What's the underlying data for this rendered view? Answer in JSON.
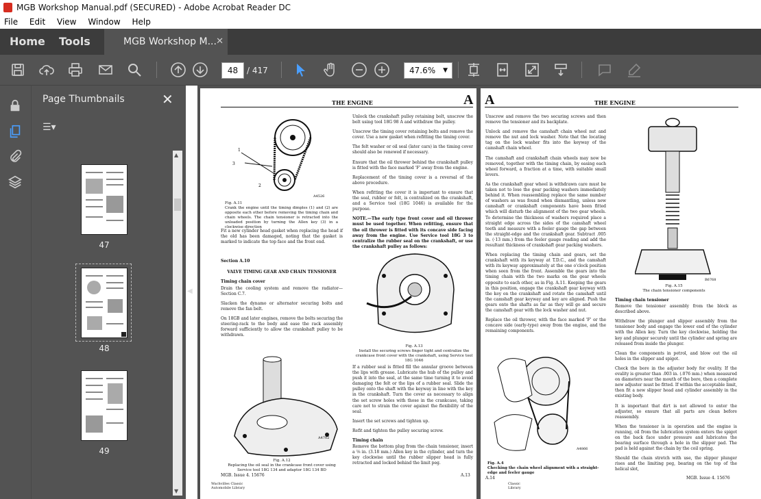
{
  "window": {
    "title": "MGB Workshop Manual.pdf (SECURED) - Adobe Acrobat Reader DC"
  },
  "menu": [
    "File",
    "Edit",
    "View",
    "Window",
    "Help"
  ],
  "tabs": {
    "home": "Home",
    "tools": "Tools",
    "doc": "MGB Workshop M...",
    "close": "✕"
  },
  "toolbar": {
    "page_current": "48",
    "page_total": "/ 417",
    "zoom": "47.6%",
    "zoom_arrow": "▼"
  },
  "thumbnails": {
    "title": "Page Thumbnails",
    "close": "✕",
    "options": "☰▾",
    "pages": [
      "47",
      "48",
      "49"
    ]
  },
  "left_page": {
    "header": "THE ENGINE",
    "letter": "A",
    "fig11_caption": "Fig. A.11\nCrank the engine until the timing dimples (1) and (2) are opposite each other before removing the timing chain and chain wheels. The chain tensioner is retracted into the unloaded position by turning the Allen key (3) in a clockwise direction",
    "col1_after_fig": "Fit a new cylinder head gasket when replacing the head if the old has been damaged, noting that the gasket is marked to indicate the top face and the front end.",
    "section": "Section A.10",
    "section_title": "VALVE TIMING GEAR AND CHAIN TENSIONER",
    "sub_timing_cover": "Timing chain cover",
    "col1_p1": "Drain the cooling system and remove the radiator—Section C.7.",
    "col1_p2": "Slacken the dynamo or alternator securing bolts and remove the fan belt.",
    "col1_p3": "On 18GB and later engines, remove the bolts securing the steering-rack to the body and ease the rack assembly forward sufficiently to allow the crankshaft pulley to be withdrawn.",
    "fig12_caption": "Fig. A.12\nReplacing the oil seal in the crankcase front cover using Service tool 18G 134 and adaptor 18G 134 BD",
    "col2_p1": "Unlock the crankshaft pulley retaining bolt, unscrew the bolt using tool 18G 98 A and withdraw the pulley.",
    "col2_p2": "Unscrew the timing cover retaining bolts and remove the cover. Use a new gasket when refitting the timing cover.",
    "col2_p3": "The felt washer or oil seal (later cars) in the timing cover should also be renewed if necessary.",
    "col2_p4": "Ensure that the oil thrower behind the crankshaft pulley is fitted with the face marked 'F' away from the engine.",
    "col2_p5": "Replacement of the timing cover is a reversal of the above procedure.",
    "col2_p6": "When refitting the cover it is important to ensure that the seal, rubber or felt, is centralized on the crankshaft, and a Service tool (18G 1046) is available for the purpose.",
    "col2_note": "NOTE.—The early type front cover and oil thrower must be used together. When refitting, ensure that the oil thrower is fitted with its concave side facing away from the engine. Use Service tool 18G 3 to centralize the rubber seal on the crankshaft, or use the crankshaft pulley as follows:",
    "fig13_caption": "Fig. A.13\nInstall the securing screws finger tight and centralize the crankcase front cover with the crankshaft, using Service tool 18G 1046",
    "col2_p7": "If a rubber seal is fitted fill the annular groove between the lips with grease. Lubricate the hub of the pulley and push it into the seal, at the same time turning it to avoid damaging the felt or the lips of a rubber seal. Slide the pulley onto the shaft with the keyway in line with the key in the crankshaft. Turn the cover as necessary to align the set screw holes with those in the crankcase, taking care not to strain the cover against the flexibility of the seal.",
    "col2_p8": "Insert the set screws and tighten up.",
    "col2_p9": "Refit and tighten the pulley securing screw.",
    "sub_timing_chain": "Timing chain",
    "col2_p10": "Remove the bottom plug from the chain tensioner, insert a ⅛ in. (3.18 mm.) Allen key in the cylinder, and turn the key clockwise until the rubber slipper head is fully retracted and locked behind the limit peg.",
    "footer_left": "MGB.    Issue 4.    15676",
    "footer_right": "A.13",
    "library": "Wachvilles Classic\nAutomobile Library"
  },
  "right_page": {
    "header": "THE ENGINE",
    "letter": "A",
    "p1": "Unscrew and remove the two securing screws and then remove the tensioner and its backplate.",
    "p2": "Unlock and remove the camshaft chain wheel nut and remove the nut and lock washer. Note that the locating tag on the lock washer fits into the keyway of the camshaft chain wheel.",
    "p3": "The camshaft and crankshaft chain wheels may now be removed, together with the timing chain, by easing each wheel forward, a fraction at a time, with suitable small levers.",
    "p4": "As the crankshaft gear wheel is withdrawn care must be taken not to lose the gear packing washers immediately behind it. When reassembling replace the same number of washers as was found when dismantling, unless new camshaft or crankshaft components have been fitted which will disturb the alignment of the two gear wheels. To determine the thickness of washers required place a straight edge across the sides of the camshaft wheel teeth and measure with a feeler gauge the gap between the straight-edge and the crankshaft gear. Subtract .005 in. (·13 mm.) from the feeler gauge reading and add the resultant thickness of crankshaft gear packing washers.",
    "p5": "When replacing the timing chain and gears, set the crankshaft with its keyway at T.D.C., and the camshaft with its keyway approximately at the one o'clock position when seen from the front. Assemble the gears into the timing chain with the two marks on the gear wheels opposite to each other, as in Fig. A.11. Keeping the gears in this position, engage the crankshaft gear keyway with the key on the crankshaft and rotate the camshaft until the camshaft gear keyway and key are aligned. Push the gears onto the shafts as far as they will go and secure the camshaft gear with the lock washer and nut.",
    "p6": "Replace the oil thrower, with the face marked 'F' or the concave side (early-type) away from the engine, and the remaining components.",
    "fig15_caption": "Fig. A.15\nThe chain tensioner components",
    "sub_tensioner": "Timing chain tensioner",
    "t1": "Remove the tensioner assembly from the block as described above.",
    "t2": "Withdraw the plunger and slipper assembly from the tensioner body and engage the lower end of the cylinder with the Allen key. Turn the key clockwise, holding the key and plunger securely until the cylinder and spring are released from inside the plunger.",
    "t3": "Clean the components in petrol, and blow out the oil holes in the slipper and spigot.",
    "t4": "Check the bore in the adjuster body for ovality. If the ovality is greater than .003 in. (.076 mm.) when measured on diameters near the mouth of the bore, then a complete new adjuster must be fitted. If within the acceptable limit, then fit a new slipper head and cylinder assembly in the existing body.",
    "t5": "It is important that dirt is not allowed to enter the adjuster, so ensure that all parts are clean before reassembly.",
    "t6": "When the tensioner is in operation and the engine is running, oil from the lubrication system enters the spigot on the back face under pressure and lubricates the bearing surface through a hole in the slipper pad. The pad is held against the chain by the coil spring.",
    "t7": "Should the chain stretch with use, the slipper plunger rises and the limiting peg, bearing on the top of the helical slot,",
    "fig14_caption": "Fig. A.4\nChecking the chain wheel alignment with a straight-edge and feeler gauge",
    "footer_left": "A.14",
    "footer_right": "MGB.    Issue 4.    15676",
    "library": "Classic\nLibrary"
  }
}
